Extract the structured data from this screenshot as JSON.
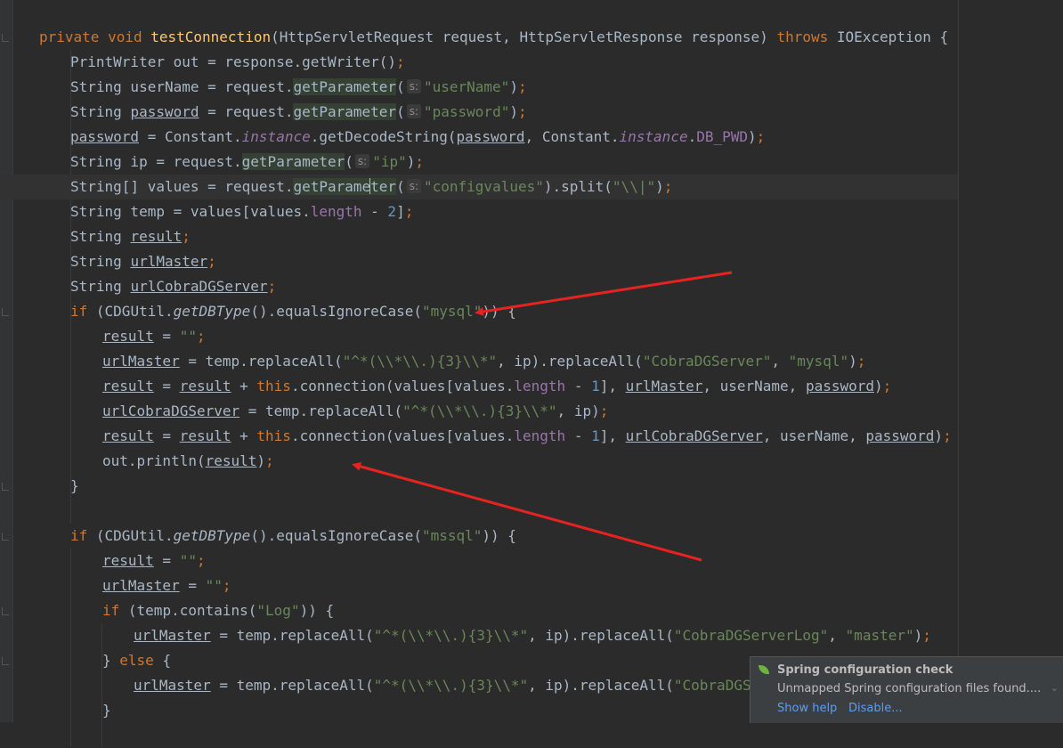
{
  "code": {
    "l01": [
      {
        "t": "private void ",
        "c": "kw"
      },
      {
        "t": "testConnection",
        "c": "fn"
      },
      {
        "t": "(HttpServletRequest request, HttpServletResponse response) "
      },
      {
        "t": "throws ",
        "c": "kw"
      },
      {
        "t": "IOException {"
      }
    ],
    "l02": [
      {
        "t": "PrintWriter out = response.getWriter()"
      },
      {
        "t": ";",
        "c": "kw"
      }
    ],
    "l03": [
      {
        "t": "String userName = request."
      },
      {
        "t": "getParameter",
        "c": "hl"
      },
      {
        "t": "("
      },
      {
        "t": "s:",
        "c": "hint"
      },
      {
        "t": "\"userName\"",
        "c": "str"
      },
      {
        "t": ")"
      },
      {
        "t": ";",
        "c": "kw"
      }
    ],
    "l04": [
      {
        "t": "String "
      },
      {
        "t": "password",
        "c": "ul"
      },
      {
        "t": " = request."
      },
      {
        "t": "getParameter",
        "c": "hl"
      },
      {
        "t": "("
      },
      {
        "t": "s:",
        "c": "hint"
      },
      {
        "t": "\"password\"",
        "c": "str"
      },
      {
        "t": ")"
      },
      {
        "t": ";",
        "c": "kw"
      }
    ],
    "l05": [
      {
        "t": "password",
        "c": "ul"
      },
      {
        "t": " = Constant."
      },
      {
        "t": "instance",
        "c": "fld it"
      },
      {
        "t": ".getDecodeString("
      },
      {
        "t": "password",
        "c": "ul"
      },
      {
        "t": ", Constant."
      },
      {
        "t": "instance",
        "c": "fld it"
      },
      {
        "t": "."
      },
      {
        "t": "DB_PWD",
        "c": "fld"
      },
      {
        "t": ")"
      },
      {
        "t": ";",
        "c": "kw"
      }
    ],
    "l06": [
      {
        "t": "String ip = request."
      },
      {
        "t": "getParameter",
        "c": "hl"
      },
      {
        "t": "("
      },
      {
        "t": "s:",
        "c": "hint"
      },
      {
        "t": "\"ip\"",
        "c": "str"
      },
      {
        "t": ")"
      },
      {
        "t": ";",
        "c": "kw"
      }
    ],
    "l07": [
      {
        "t": "String[] values = request."
      },
      {
        "t": "getParame",
        "c": "hl"
      },
      {
        "t": "",
        "c": "caret"
      },
      {
        "t": "ter",
        "c": "hl"
      },
      {
        "t": "("
      },
      {
        "t": "s:",
        "c": "hint"
      },
      {
        "t": "\"configvalues\"",
        "c": "str"
      },
      {
        "t": ").split("
      },
      {
        "t": "\"\\\\|\"",
        "c": "str"
      },
      {
        "t": ")"
      },
      {
        "t": ";",
        "c": "kw"
      }
    ],
    "l08": [
      {
        "t": "String temp = values[values."
      },
      {
        "t": "length",
        "c": "fld"
      },
      {
        "t": " - "
      },
      {
        "t": "2",
        "c": "num"
      },
      {
        "t": "]"
      },
      {
        "t": ";",
        "c": "kw"
      }
    ],
    "l09": [
      {
        "t": "String "
      },
      {
        "t": "result",
        "c": "ul"
      },
      {
        "t": ";",
        "c": "kw"
      }
    ],
    "l10": [
      {
        "t": "String "
      },
      {
        "t": "urlMaster",
        "c": "ul"
      },
      {
        "t": ";",
        "c": "kw"
      }
    ],
    "l11": [
      {
        "t": "String "
      },
      {
        "t": "urlCobraDGServer",
        "c": "ul"
      },
      {
        "t": ";",
        "c": "kw"
      }
    ],
    "l12": [
      {
        "t": "if ",
        "c": "kw"
      },
      {
        "t": "(CDGUtil."
      },
      {
        "t": "getDBType",
        "c": "it"
      },
      {
        "t": "().equalsIgnoreCase("
      },
      {
        "t": "\"mysql\"",
        "c": "str"
      },
      {
        "t": ")) {"
      }
    ],
    "l13": [
      {
        "t": "result",
        "c": "ul"
      },
      {
        "t": " = "
      },
      {
        "t": "\"\"",
        "c": "str"
      },
      {
        "t": ";",
        "c": "kw"
      }
    ],
    "l14": [
      {
        "t": "urlMaster",
        "c": "ul"
      },
      {
        "t": " = temp.replaceAll("
      },
      {
        "t": "\"^*(\\\\*\\\\.){3}\\\\*\"",
        "c": "str"
      },
      {
        "t": ", ip).replaceAll("
      },
      {
        "t": "\"CobraDGServer\"",
        "c": "str"
      },
      {
        "t": ", "
      },
      {
        "t": "\"mysql\"",
        "c": "str"
      },
      {
        "t": ")"
      },
      {
        "t": ";",
        "c": "kw"
      }
    ],
    "l15": [
      {
        "t": "result",
        "c": "ul"
      },
      {
        "t": " = "
      },
      {
        "t": "result",
        "c": "ul"
      },
      {
        "t": " + "
      },
      {
        "t": "this",
        "c": "kw"
      },
      {
        "t": ".connection(values[values."
      },
      {
        "t": "length",
        "c": "fld"
      },
      {
        "t": " - "
      },
      {
        "t": "1",
        "c": "num"
      },
      {
        "t": "], "
      },
      {
        "t": "urlMaster",
        "c": "ul"
      },
      {
        "t": ", userName, "
      },
      {
        "t": "password",
        "c": "ul"
      },
      {
        "t": ")"
      },
      {
        "t": ";",
        "c": "kw"
      }
    ],
    "l16": [
      {
        "t": "urlCobraDGServer",
        "c": "ul"
      },
      {
        "t": " = temp.replaceAll("
      },
      {
        "t": "\"^*(\\\\*\\\\.){3}\\\\*\"",
        "c": "str"
      },
      {
        "t": ", ip)"
      },
      {
        "t": ";",
        "c": "kw"
      }
    ],
    "l17": [
      {
        "t": "result",
        "c": "ul"
      },
      {
        "t": " = "
      },
      {
        "t": "result",
        "c": "ul"
      },
      {
        "t": " + "
      },
      {
        "t": "this",
        "c": "kw"
      },
      {
        "t": ".connection(values[values."
      },
      {
        "t": "length",
        "c": "fld"
      },
      {
        "t": " - "
      },
      {
        "t": "1",
        "c": "num"
      },
      {
        "t": "], "
      },
      {
        "t": "urlCobraDGServer",
        "c": "ul"
      },
      {
        "t": ", userName, "
      },
      {
        "t": "password",
        "c": "ul"
      },
      {
        "t": ")"
      },
      {
        "t": ";",
        "c": "kw"
      }
    ],
    "l18": [
      {
        "t": "out.println("
      },
      {
        "t": "result",
        "c": "ul"
      },
      {
        "t": ")"
      },
      {
        "t": ";",
        "c": "kw"
      }
    ],
    "l19": [
      {
        "t": "}"
      }
    ],
    "l20": [],
    "l21": [
      {
        "t": "if ",
        "c": "kw"
      },
      {
        "t": "(CDGUtil."
      },
      {
        "t": "getDBType",
        "c": "it"
      },
      {
        "t": "().equalsIgnoreCase("
      },
      {
        "t": "\"mssql\"",
        "c": "str"
      },
      {
        "t": ")) {"
      }
    ],
    "l22": [
      {
        "t": "result",
        "c": "ul"
      },
      {
        "t": " = "
      },
      {
        "t": "\"\"",
        "c": "str"
      },
      {
        "t": ";",
        "c": "kw"
      }
    ],
    "l23": [
      {
        "t": "urlMaster",
        "c": "ul"
      },
      {
        "t": " = "
      },
      {
        "t": "\"\"",
        "c": "str"
      },
      {
        "t": ";",
        "c": "kw"
      }
    ],
    "l24": [
      {
        "t": "if ",
        "c": "kw"
      },
      {
        "t": "(temp.contains("
      },
      {
        "t": "\"Log\"",
        "c": "str"
      },
      {
        "t": ")) {"
      }
    ],
    "l25": [
      {
        "t": "urlMaster",
        "c": "ul"
      },
      {
        "t": " = temp.replaceAll("
      },
      {
        "t": "\"^*(\\\\*\\\\.){3}\\\\*\"",
        "c": "str"
      },
      {
        "t": ", ip).replaceAll("
      },
      {
        "t": "\"CobraDGServerLog\"",
        "c": "str"
      },
      {
        "t": ", "
      },
      {
        "t": "\"master\"",
        "c": "str"
      },
      {
        "t": ")"
      },
      {
        "t": ";",
        "c": "kw"
      }
    ],
    "l26": [
      {
        "t": "} "
      },
      {
        "t": "else ",
        "c": "kw"
      },
      {
        "t": "{"
      }
    ],
    "l27": [
      {
        "t": "urlMaster",
        "c": "ul"
      },
      {
        "t": " = temp.replaceAll("
      },
      {
        "t": "\"^*(\\\\*\\\\.){3}\\\\*\"",
        "c": "str"
      },
      {
        "t": ", ip).replaceAll("
      },
      {
        "t": "\"CobraDGServer",
        "c": "str"
      }
    ],
    "l28": [
      {
        "t": "}"
      }
    ]
  },
  "notification": {
    "icon": "spring-leaf-icon",
    "title": "Spring configuration check",
    "body": "Unmapped Spring configuration files found....",
    "show_help": "Show help",
    "disable": "Disable...",
    "colors": {
      "link": "#589df6",
      "leaf": "#6cb33f"
    }
  },
  "annotations": {
    "arrow_color": "#e52320",
    "count": 2
  },
  "theme": {
    "background": "#2b2b2b",
    "keyword": "#cc7832",
    "method_decl": "#ffc66d",
    "string": "#6a8759",
    "number": "#6897bb",
    "field": "#9876aa",
    "text": "#a9b7c6"
  }
}
